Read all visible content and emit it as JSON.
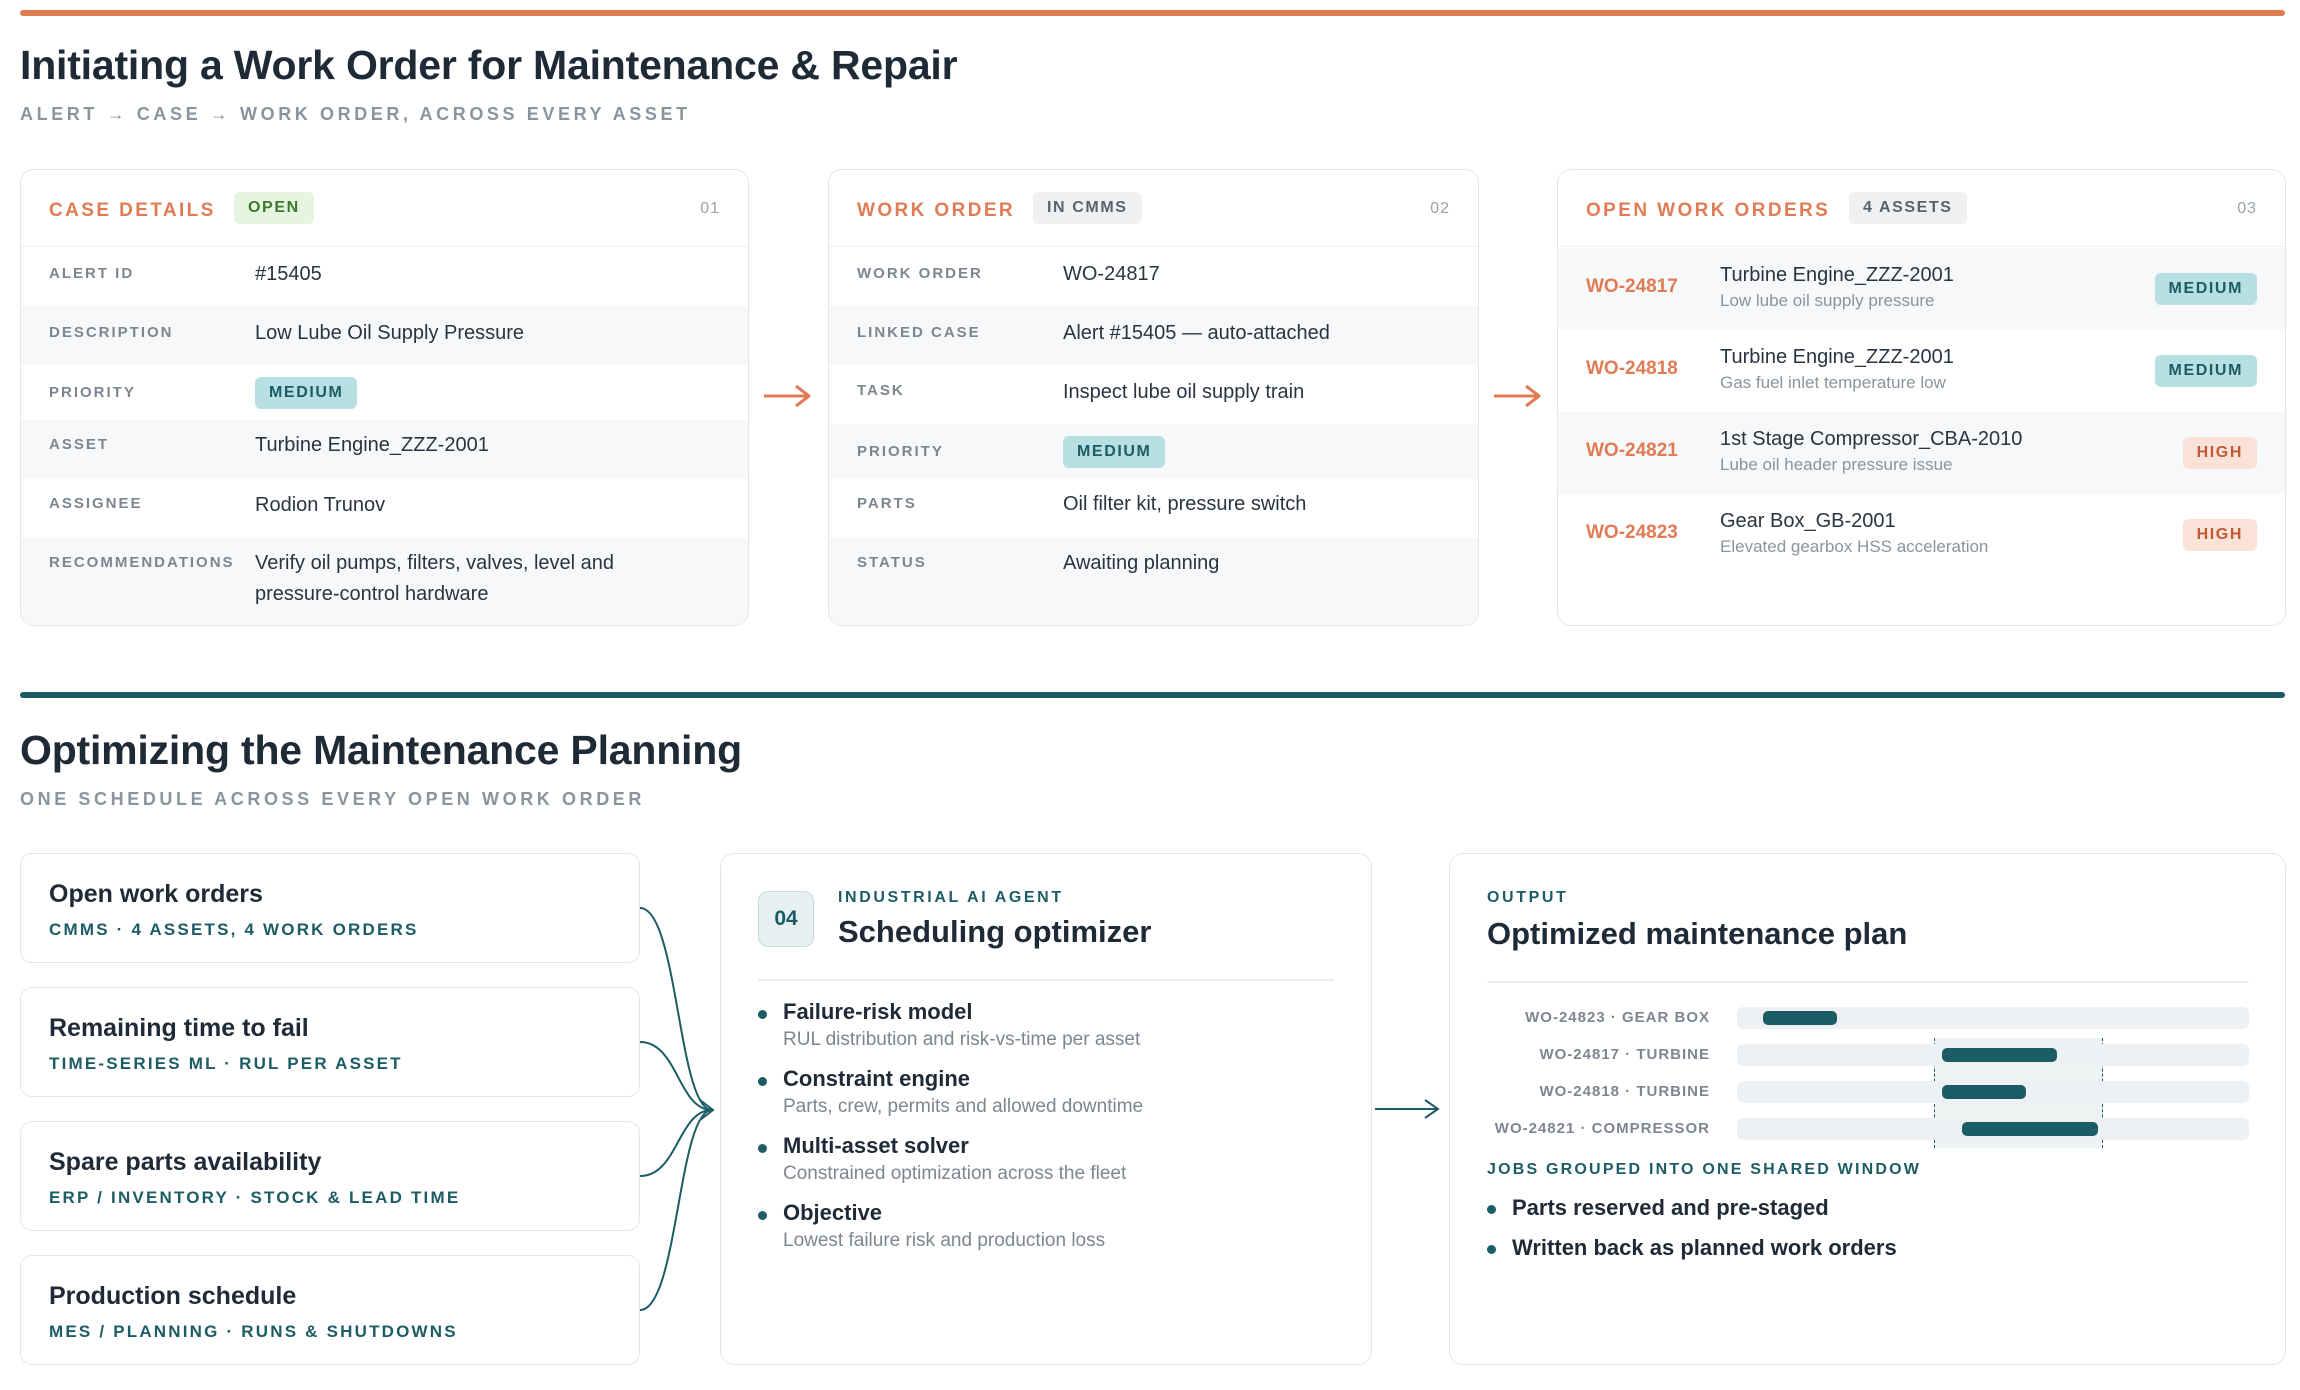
{
  "section1": {
    "title": "Initiating a Work Order for Maintenance & Repair",
    "subtitle": "ALERT → CASE → WORK ORDER, ACROSS EVERY ASSET"
  },
  "case_details": {
    "title": "CASE DETAILS",
    "status": "OPEN",
    "num": "01",
    "rows": [
      {
        "label": "ALERT ID",
        "value": "#15405"
      },
      {
        "label": "DESCRIPTION",
        "value": "Low Lube Oil Supply Pressure"
      },
      {
        "label": "PRIORITY",
        "value": "MEDIUM"
      },
      {
        "label": "ASSET",
        "value": "Turbine Engine_ZZZ-2001"
      },
      {
        "label": "ASSIGNEE",
        "value": "Rodion Trunov"
      },
      {
        "label": "RECOMMENDATIONS",
        "value": "Verify oil pumps, filters, valves, level and pressure-control hardware"
      }
    ]
  },
  "work_order": {
    "title": "WORK ORDER",
    "status": "IN CMMS",
    "num": "02",
    "rows": [
      {
        "label": "WORK ORDER",
        "value": "WO-24817"
      },
      {
        "label": "LINKED CASE",
        "value": "Alert #15405 — auto-attached"
      },
      {
        "label": "TASK",
        "value": "Inspect lube oil supply train"
      },
      {
        "label": "PRIORITY",
        "value": "MEDIUM"
      },
      {
        "label": "PARTS",
        "value": "Oil filter kit, pressure switch"
      },
      {
        "label": "STATUS",
        "value": "Awaiting planning"
      }
    ]
  },
  "open_work_orders": {
    "title": "OPEN WORK ORDERS",
    "count": "4 ASSETS",
    "num": "03",
    "items": [
      {
        "id": "WO-24817",
        "asset": "Turbine Engine_ZZZ-2001",
        "issue": "Low lube oil supply pressure",
        "priority": "MEDIUM"
      },
      {
        "id": "WO-24818",
        "asset": "Turbine Engine_ZZZ-2001",
        "issue": "Gas fuel inlet temperature low",
        "priority": "MEDIUM"
      },
      {
        "id": "WO-24821",
        "asset": "1st Stage Compressor_CBA-2010",
        "issue": "Lube oil header pressure issue",
        "priority": "HIGH"
      },
      {
        "id": "WO-24823",
        "asset": "Gear Box_GB-2001",
        "issue": "Elevated gearbox HSS acceleration",
        "priority": "HIGH"
      }
    ]
  },
  "section2": {
    "title": "Optimizing the Maintenance Planning",
    "subtitle": "ONE SCHEDULE ACROSS EVERY OPEN WORK ORDER"
  },
  "inputs": [
    {
      "title": "Open work orders",
      "sub": "CMMS · 4 ASSETS, 4 WORK ORDERS"
    },
    {
      "title": "Remaining time to fail",
      "sub": "TIME-SERIES ML · RUL PER ASSET"
    },
    {
      "title": "Spare parts availability",
      "sub": "ERP / INVENTORY · STOCK & LEAD TIME"
    },
    {
      "title": "Production schedule",
      "sub": "MES / PLANNING · RUNS & SHUTDOWNS"
    }
  ],
  "optimizer": {
    "badge": "04",
    "kicker": "INDUSTRIAL AI AGENT",
    "title": "Scheduling optimizer",
    "bullets": [
      {
        "title": "Failure-risk model",
        "desc": "RUL distribution and risk-vs-time per asset"
      },
      {
        "title": "Constraint engine",
        "desc": "Parts, crew, permits and allowed downtime"
      },
      {
        "title": "Multi-asset solver",
        "desc": "Constrained optimization across the fleet"
      },
      {
        "title": "Objective",
        "desc": "Lowest failure risk and production loss"
      }
    ]
  },
  "output": {
    "kicker": "OUTPUT",
    "title": "Optimized maintenance plan",
    "gantt": [
      {
        "label": "WO-24823 · GEAR BOX",
        "start": 0.05,
        "end": 0.195
      },
      {
        "label": "WO-24817 · TURBINE",
        "start": 0.4,
        "end": 0.625
      },
      {
        "label": "WO-24818 · TURBINE",
        "start": 0.4,
        "end": 0.565
      },
      {
        "label": "WO-24821 · COMPRESSOR",
        "start": 0.44,
        "end": 0.705
      }
    ],
    "shared_window": {
      "start": 0.385,
      "end": 0.715
    },
    "window_caption": "JOBS GROUPED INTO ONE SHARED WINDOW",
    "bullets": [
      "Parts reserved and pre-staged",
      "Written back as planned work orders"
    ]
  },
  "colors": {
    "accent": "#e07b54",
    "teal": "#1c5c64",
    "medium_bg": "#b8e0e3",
    "high_bg": "#fbe2d8"
  }
}
